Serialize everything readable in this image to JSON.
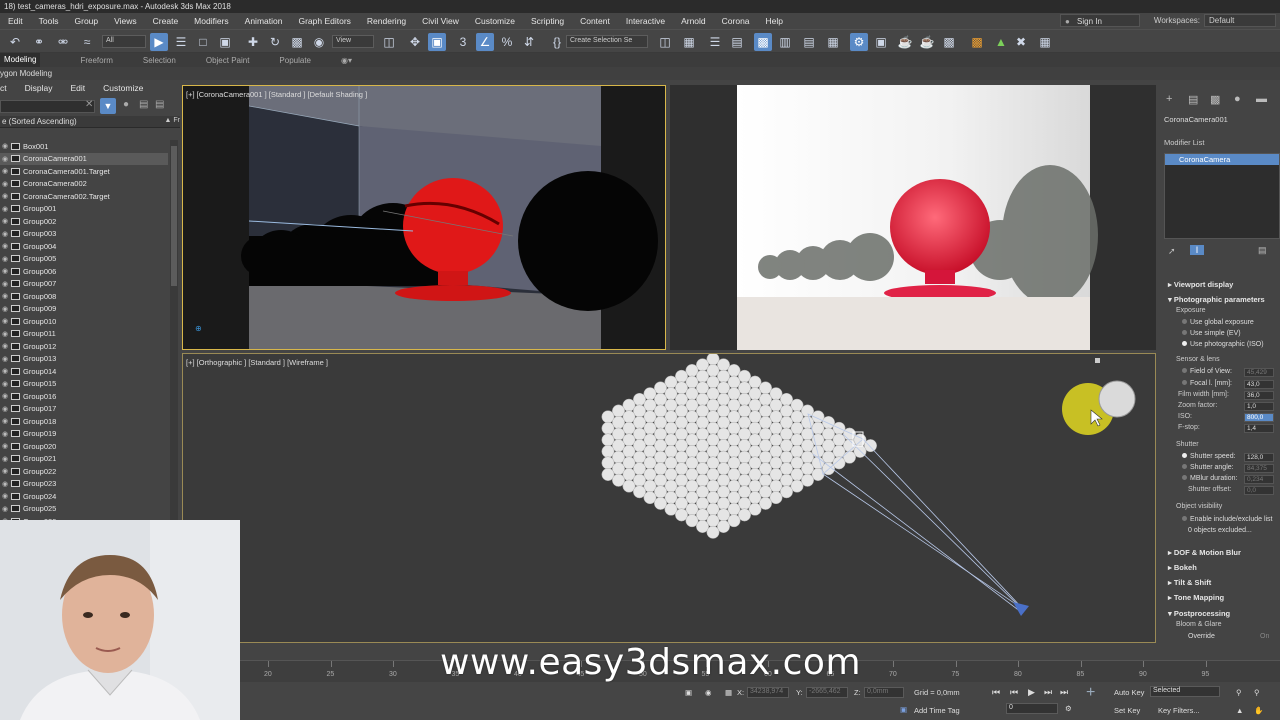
{
  "window": {
    "title": "18) test_cameras_hdri_exposure.max - Autodesk 3ds Max 2018"
  },
  "menu": [
    "Edit",
    "Tools",
    "Group",
    "Views",
    "Create",
    "Modifiers",
    "Animation",
    "Graph Editors",
    "Rendering",
    "Civil View",
    "Customize",
    "Scripting",
    "Content",
    "Interactive",
    "Arnold",
    "Corona",
    "Help"
  ],
  "account": {
    "sign_in": "Sign In",
    "workspaces_label": "Workspaces:",
    "workspace": "Default"
  },
  "toolbar": {
    "filter": "All",
    "ref_coord": "View",
    "selection_set": "Create Selection Se"
  },
  "ribbon": {
    "tabs": [
      "Modeling",
      "Freeform",
      "Selection",
      "Object Paint",
      "Populate"
    ],
    "panel": "ygon Modeling"
  },
  "explorer": {
    "menu": [
      "ct",
      "Display",
      "Edit",
      "Customize"
    ],
    "header": "e (Sorted Ascending)",
    "header_right": "Fr",
    "items": [
      "Box001",
      "CoronaCamera001",
      "CoronaCamera001.Target",
      "CoronaCamera002",
      "CoronaCamera002.Target",
      "Group001",
      "Group002",
      "Group003",
      "Group004",
      "Group005",
      "Group006",
      "Group007",
      "Group008",
      "Group009",
      "Group010",
      "Group011",
      "Group012",
      "Group013",
      "Group014",
      "Group015",
      "Group016",
      "Group017",
      "Group018",
      "Group019",
      "Group020",
      "Group021",
      "Group022",
      "Group023",
      "Group024",
      "Group025",
      "Group026"
    ],
    "selected": "CoronaCamera001"
  },
  "viewports": {
    "top_left_label": "[+] [CoronaCamera001 ] [Standard ] [Default Shading ]",
    "bottom_label": "[+] [Orthographic ] [Standard ] [Wireframe ]"
  },
  "command_panel": {
    "object_name": "CoronaCamera001",
    "modifier_list": "Modifier List",
    "stack_item": "CoronaCamera",
    "viewport_display": "Viewport display",
    "photographic": "Photographic parameters",
    "exposure": "Exposure",
    "use_global": "Use global exposure",
    "use_simple": "Use simple (EV)",
    "use_photo": "Use photographic (ISO)",
    "sensor_lens": "Sensor & lens",
    "fov": "Field of View:",
    "fov_val": "45,429",
    "focal": "Focal l. [mm]:",
    "focal_val": "43,0",
    "film": "Film width [mm]:",
    "film_val": "36,0",
    "zoom": "Zoom factor:",
    "zoom_val": "1,0",
    "iso": "ISO:",
    "iso_val": "800,0",
    "fstop": "F-stop:",
    "fstop_val": "1,4",
    "shutter": "Shutter",
    "shutter_speed": "Shutter speed:",
    "shutter_speed_val": "128,0",
    "shutter_angle": "Shutter angle:",
    "shutter_angle_val": "84,375",
    "mblur": "MBlur duration:",
    "mblur_val": "0,234",
    "shutter_offset": "Shutter offset:",
    "shutter_offset_val": "0,0",
    "obj_vis": "Object visibility",
    "enable_list": "Enable include/exclude list",
    "excluded": "0 objects excluded...",
    "dof": "DOF & Motion Blur",
    "bokeh": "Bokeh",
    "tilt": "Tilt & Shift",
    "tone": "Tone Mapping",
    "post": "Postprocessing",
    "bloom": "Bloom & Glare",
    "override": "Override",
    "on": "On"
  },
  "timeline": {
    "ticks": [
      "20",
      "25",
      "30",
      "35",
      "40",
      "45",
      "50",
      "55",
      "60",
      "65",
      "70",
      "75",
      "80",
      "85",
      "90",
      "95"
    ]
  },
  "status": {
    "x_label": "X:",
    "x_val": "34238,974",
    "y_label": "Y:",
    "y_val": "-2665,462",
    "z_label": "Z:",
    "z_val": "0,0mm",
    "grid": "Grid = 0,0mm",
    "add_time_tag": "Add Time Tag",
    "auto_key": "Auto Key",
    "selected": "Selected",
    "set_key": "Set Key",
    "key_filters": "Key Filters...",
    "frame": "0"
  },
  "watermark": "www.easy3dsmax.com"
}
